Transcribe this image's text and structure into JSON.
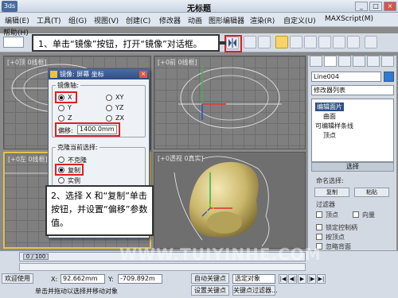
{
  "window": {
    "title": "无标题",
    "minimize": "_",
    "maximize": "□",
    "close": "×"
  },
  "menu": {
    "items": [
      "编辑(E)",
      "工具(T)",
      "组(G)",
      "视图(V)",
      "创建(C)",
      "修改器",
      "动画",
      "图形编辑器",
      "渲染(R)",
      "自定义(U)",
      "MAXScript(M)"
    ],
    "help": "帮助(H)"
  },
  "viewports": {
    "top_left": "[+0顶 0线框]",
    "top_right": "[+0前 0线框]",
    "bottom_left": "[+0左 0线框]",
    "bottom_right": "[+0透视 0真实]"
  },
  "callouts": {
    "step1": "1、单击“镜像”按钮，打开“镜像”对话框。",
    "step2": "2、选择 X 和“复制”单击按钮，并设置“偏移”参数值。"
  },
  "dialog": {
    "title": "镜像: 屏幕 坐标",
    "close": "×",
    "axis_group": "镜像轴:",
    "axes": [
      "X",
      "Y",
      "Z",
      "XY",
      "YZ",
      "ZX"
    ],
    "selected_axis": "X",
    "offset_label": "偏移:",
    "offset_value": "1400.0mm",
    "clone_group": "克隆当前选择:",
    "clone_options": [
      "不克隆",
      "复制",
      "实例"
    ],
    "selected_clone": "复制"
  },
  "right_panel": {
    "object_name": "Line004",
    "modifier_list": "修改器列表",
    "stack": [
      "编辑面片",
      "曲面",
      "可编辑样条线",
      "顶点"
    ],
    "selection_section": "选择",
    "named_selection": "命名选择:",
    "copy_btn": "复制",
    "paste_btn": "粘贴",
    "filter_label": "过滤器",
    "vertex_chk": "顶点",
    "vector_chk": "向量",
    "lock_handles": "锁定控制柄",
    "by_vertex": "按顶点",
    "ignore_back": "忽略背面",
    "shrink_btn": "收缩",
    "grow_btn": "扩大"
  },
  "timeline": {
    "frame_display": "0 / 100"
  },
  "status": {
    "welcome": "欢迎使用",
    "prompt": "单击并拖动以选择并移动对象",
    "x_label": "X:",
    "x_value": "92.662mm",
    "y_label": "Y:",
    "y_value": "-709.892m",
    "auto_key": "自动关键点",
    "selected_obj": "选定对象",
    "set_key": "设置关键点",
    "key_filters": "关键点过滤器..."
  },
  "watermark": "WWW.TUIYINHE.COM"
}
